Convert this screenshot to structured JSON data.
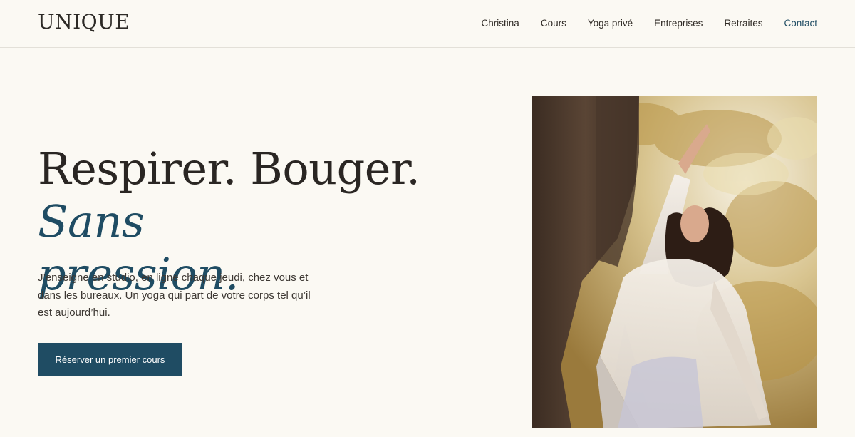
{
  "header": {
    "logo": "UNIQUE",
    "nav": [
      "Christina",
      "Cours",
      "Yoga privé",
      "Entreprises",
      "Retraites",
      "Contact"
    ]
  },
  "hero": {
    "headline_plain": "Respirer. Bouger.",
    "headline_accent_1": "Sans",
    "headline_accent_2": "pression.",
    "lede": "J’enseigne en studio, en ligne chaque jeudi, chez vous et dans les bureaux. Un yoga qui part de votre corps tel qu’il est aujourd’hui.",
    "cta": "Réserver un premier cours"
  },
  "colors": {
    "background": "#fbf9f3",
    "accent": "#1f4c63",
    "text": "#2a2623"
  }
}
